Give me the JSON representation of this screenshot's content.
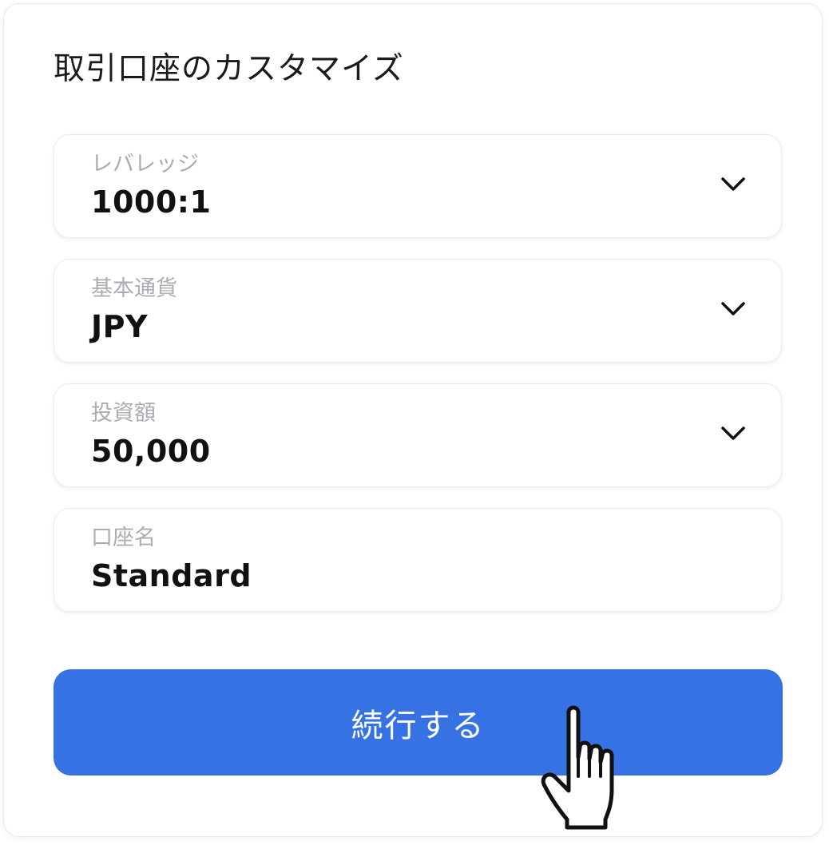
{
  "card": {
    "title": "取引口座のカスタマイズ"
  },
  "fields": [
    {
      "label": "レバレッジ",
      "value": "1000:1",
      "icon": "chevron-down-icon"
    },
    {
      "label": "基本通貨",
      "value": "JPY",
      "icon": "chevron-down-icon"
    },
    {
      "label": "投資額",
      "value": "50,000",
      "icon": "chevron-down-icon"
    },
    {
      "label": "口座名",
      "value": "Standard"
    }
  ],
  "continue_button": {
    "label": "続行する"
  },
  "cursor": {
    "icon": "hand-pointer-icon"
  },
  "colors": {
    "accent": "#3672e3",
    "label_gray": "#a9adb3",
    "text": "#111114"
  }
}
